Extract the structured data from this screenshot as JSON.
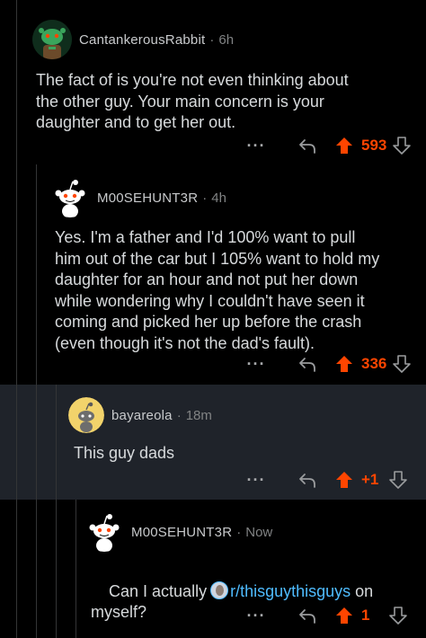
{
  "comments": [
    {
      "username": "CantankerousRabbit",
      "separator": "·",
      "time": "6h",
      "body": "The fact of is you're not even thinking about\nthe other guy. Your main concern is your\ndaughter and to get her out.",
      "more": "···",
      "score": "593",
      "avatar_color": "#3aa55c"
    },
    {
      "username": "M00SEHUNT3R",
      "separator": "·",
      "time": "4h",
      "body": "Yes. I'm a father and I'd 100% want to pull\nhim out of the car but I 105% want to hold my\ndaughter for an hour and not put her down\nwhile wondering why I couldn't have seen it\ncoming and picked her up before the crash\n(even though it's not the dad's fault).",
      "more": "···",
      "score": "336",
      "avatar_color": "#ffffff"
    },
    {
      "username": "bayareola",
      "separator": "·",
      "time": "18m",
      "body": "This guy dads",
      "more": "···",
      "score": "+1",
      "avatar_color": "#f2d36b"
    },
    {
      "username": "M00SEHUNT3R",
      "separator": "·",
      "time": "Now",
      "body_before": "Can I actually",
      "subreddit": "r/thisguythisguys",
      "body_after": " on",
      "body_line2": "myself?",
      "more": "···",
      "score": "1",
      "avatar_color": "#ffffff"
    }
  ],
  "colors": {
    "upvote": "#ff4500",
    "link": "#4fbcff",
    "highlight_bg": "#1f232a",
    "background": "#000000"
  },
  "icons": [
    "snoo-avatar",
    "reply-arrow-icon",
    "upvote-arrow-icon",
    "downvote-arrow-icon",
    "more-options-icon"
  ]
}
